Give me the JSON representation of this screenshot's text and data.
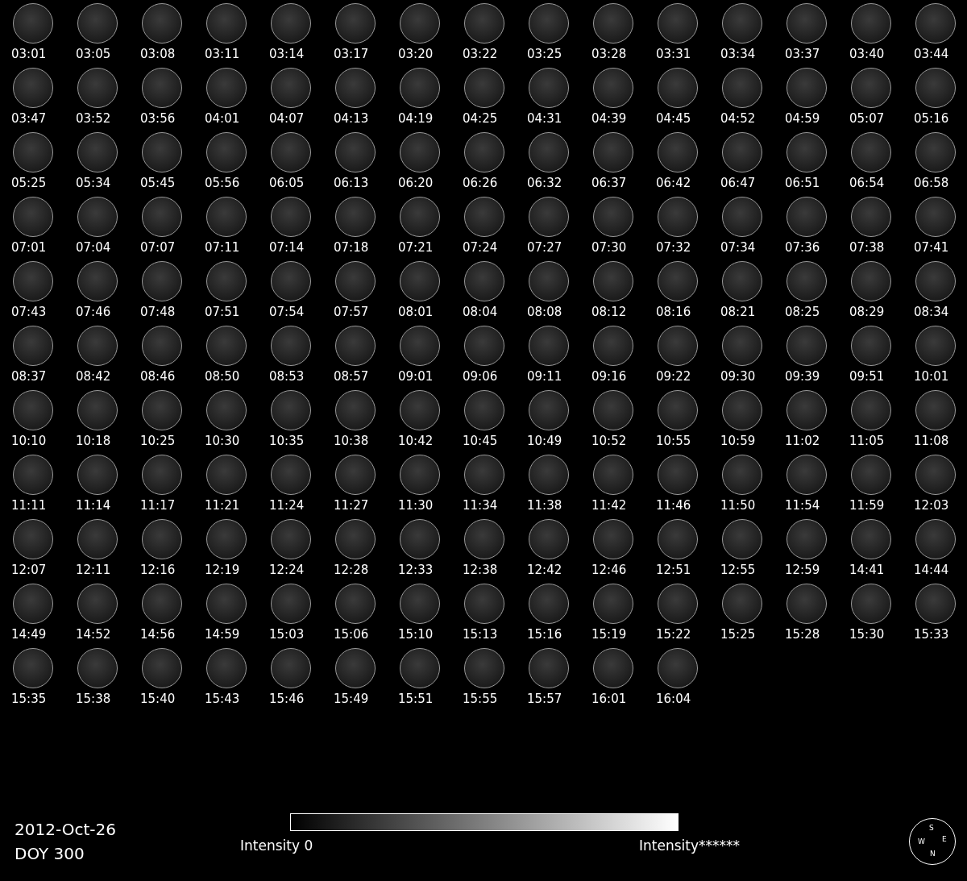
{
  "frames": [
    "03:01",
    "03:05",
    "03:08",
    "03:11",
    "03:14",
    "03:17",
    "03:20",
    "03:22",
    "03:25",
    "03:28",
    "03:31",
    "03:34",
    "03:37",
    "03:40",
    "03:44",
    "03:47",
    "03:52",
    "03:56",
    "04:01",
    "04:07",
    "04:13",
    "04:19",
    "04:25",
    "04:31",
    "04:39",
    "04:45",
    "04:52",
    "04:59",
    "05:07",
    "05:16",
    "05:25",
    "05:34",
    "05:45",
    "05:56",
    "06:05",
    "06:13",
    "06:20",
    "06:26",
    "06:32",
    "06:37",
    "06:42",
    "06:47",
    "06:51",
    "06:54",
    "06:58",
    "07:01",
    "07:04",
    "07:07",
    "07:11",
    "07:14",
    "07:18",
    "07:21",
    "07:24",
    "07:27",
    "07:30",
    "07:32",
    "07:34",
    "07:36",
    "07:38",
    "07:41",
    "07:43",
    "07:46",
    "07:48",
    "07:51",
    "07:54",
    "07:57",
    "08:01",
    "08:04",
    "08:08",
    "08:12",
    "08:16",
    "08:21",
    "08:25",
    "08:29",
    "08:34",
    "08:37",
    "08:42",
    "08:46",
    "08:50",
    "08:53",
    "08:57",
    "09:01",
    "09:06",
    "09:11",
    "09:16",
    "09:22",
    "09:30",
    "09:39",
    "09:51",
    "10:01",
    "10:10",
    "10:18",
    "10:25",
    "10:30",
    "10:35",
    "10:38",
    "10:42",
    "10:45",
    "10:49",
    "10:52",
    "10:55",
    "10:59",
    "11:02",
    "11:05",
    "11:08",
    "11:11",
    "11:14",
    "11:17",
    "11:21",
    "11:24",
    "11:27",
    "11:30",
    "11:34",
    "11:38",
    "11:42",
    "11:46",
    "11:50",
    "11:54",
    "11:59",
    "12:03",
    "12:07",
    "12:11",
    "12:16",
    "12:19",
    "12:24",
    "12:28",
    "12:33",
    "12:38",
    "12:42",
    "12:46",
    "12:51",
    "12:55",
    "12:59",
    "14:41",
    "14:44",
    "14:49",
    "14:52",
    "14:56",
    "14:59",
    "15:03",
    "15:06",
    "15:10",
    "15:13",
    "15:16",
    "15:19",
    "15:22",
    "15:25",
    "15:28",
    "15:30",
    "15:33",
    "15:35",
    "15:38",
    "15:40",
    "15:43",
    "15:46",
    "15:49",
    "15:51",
    "15:55",
    "15:57",
    "16:01",
    "16:04"
  ],
  "date": "2012-Oct-26",
  "doy": "DOY 300",
  "colorbar": {
    "min_label": "Intensity 0",
    "max_label": "Intensity******"
  },
  "compass": {
    "top": "S",
    "left": "W",
    "right": "E",
    "bottom": "N"
  }
}
